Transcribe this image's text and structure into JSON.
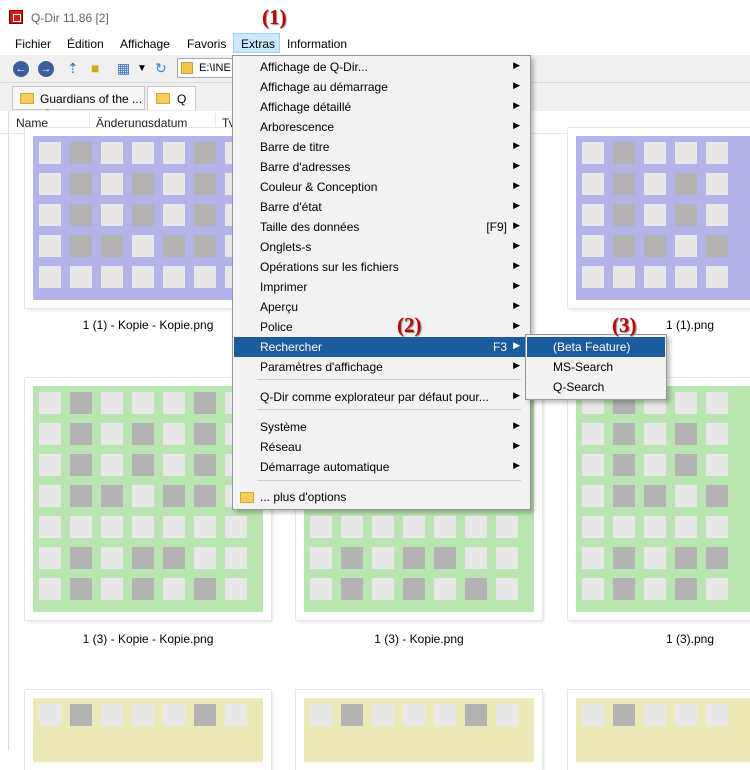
{
  "window": {
    "title": "Q-Dir 11.86 [2]"
  },
  "annotations": {
    "n1": "(1)",
    "n2": "(2)",
    "n3": "(3)"
  },
  "menubar": [
    "Fichier",
    "Édition",
    "Affichage",
    "Favoris",
    "Extras",
    "Information"
  ],
  "address": {
    "value": "E:\\INE"
  },
  "tabs": [
    {
      "label": "Guardians of the ..."
    },
    {
      "label": "Q"
    }
  ],
  "columns": [
    "Name",
    "Änderungsdatum",
    "Ty"
  ],
  "tiles": [
    {
      "caption": "1 (1) - Kopie - Kopie.png",
      "color": "#b4b4ea"
    },
    {
      "caption": "1 (1).png",
      "color": "#b4b4ea"
    },
    {
      "caption": "1 (3) - Kopie - Kopie.png",
      "color": "#b9e6b0"
    },
    {
      "caption": "1 (3) - Kopie.png",
      "color": "#b9e6b0"
    },
    {
      "caption": "1 (3).png",
      "color": "#b9e6b0"
    },
    {
      "caption": "",
      "color": "#ece9b8"
    },
    {
      "caption": "",
      "color": "#ece9b8"
    },
    {
      "caption": "",
      "color": "#ece9b8"
    }
  ],
  "extras_menu": {
    "items": [
      {
        "label": "Affichage de Q-Dir...",
        "submenu": true
      },
      {
        "label": "Affichage au démarrage",
        "submenu": true
      },
      {
        "label": "Affichage détaillé",
        "submenu": true
      },
      {
        "label": "Arborescence",
        "submenu": true
      },
      {
        "label": "Barre de titre",
        "submenu": true
      },
      {
        "label": "Barre d'adresses",
        "submenu": true
      },
      {
        "label": "Couleur & Conception",
        "submenu": true
      },
      {
        "label": "Barre d'état",
        "submenu": true
      },
      {
        "label": "Taille des données",
        "shortcut": "[F9]",
        "submenu": true
      },
      {
        "label": "Onglets-s",
        "submenu": true
      },
      {
        "label": "Opérations sur les fichiers",
        "submenu": true
      },
      {
        "label": "Imprimer",
        "submenu": true
      },
      {
        "label": "Aperçu",
        "submenu": true
      },
      {
        "label": "Police",
        "submenu": true
      },
      {
        "label": "Rechercher",
        "shortcut": "F3",
        "submenu": true,
        "highlighted": true
      },
      {
        "label": "Paramètres d'affichage",
        "submenu": true
      },
      {
        "label": "Q-Dir comme explorateur par défaut pour...",
        "submenu": true
      },
      {
        "label": "Système",
        "submenu": true
      },
      {
        "label": "Réseau",
        "submenu": true
      },
      {
        "label": "Démarrage automatique",
        "submenu": true
      },
      {
        "label": "... plus d'options",
        "submenu": false,
        "icon": "folder-icon"
      }
    ]
  },
  "search_submenu": {
    "items": [
      {
        "label": "(Beta Feature)",
        "highlighted": true
      },
      {
        "label": "MS-Search"
      },
      {
        "label": "Q-Search"
      }
    ]
  },
  "colors": {
    "highlight": "#1d5b9f",
    "annotation": "#c00000"
  }
}
